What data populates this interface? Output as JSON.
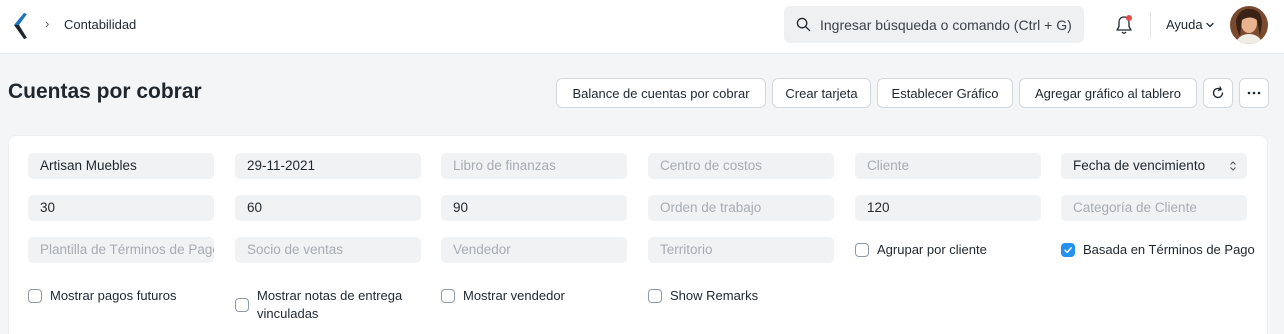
{
  "navbar": {
    "breadcrumb": "Contabilidad",
    "breadcrumb_sep": "›",
    "search_placeholder": "Ingresar búsqueda o comando (Ctrl + G)",
    "help_label": "Ayuda"
  },
  "page": {
    "title": "Cuentas por cobrar",
    "buttons": {
      "balance": "Balance de cuentas por cobrar",
      "create_card": "Crear tarjeta",
      "set_chart": "Establecer Gráfico",
      "add_chart": "Agregar gráfico al tablero"
    }
  },
  "filters": {
    "row1": {
      "company": "Artisan Muebles",
      "date": "29-11-2021",
      "finance_book": "Libro de finanzas",
      "cost_center": "Centro de costos",
      "customer": "Cliente",
      "ageing_based_on": "Fecha de vencimiento"
    },
    "row2": {
      "range1": "30",
      "range2": "60",
      "range3": "90",
      "work_order": "Orden de trabajo",
      "range4": "120",
      "customer_group": "Categoría de Cliente"
    },
    "row3": {
      "payment_terms_template": "Plantilla de Términos de Pago",
      "sales_partner": "Socio de ventas",
      "sales_person": "Vendedor",
      "territory": "Territorio",
      "group_by_customer": "Agrupar por cliente",
      "based_on_payment_terms": "Basada en Términos de Pago"
    },
    "row4": {
      "show_future_payments": "Mostrar pagos futuros",
      "show_delivery_notes": "Mostrar notas de entrega vinculadas",
      "show_sales_person": "Mostrar vendedor",
      "show_remarks": "Show Remarks"
    },
    "checked": {
      "group_by_customer": false,
      "based_on_payment_terms": true,
      "show_future_payments": false,
      "show_delivery_notes": false,
      "show_sales_person": false,
      "show_remarks": false
    }
  },
  "colors": {
    "accent": "#2490ef",
    "background": "#f4f5f6",
    "field_bg": "#f1f2f4"
  }
}
